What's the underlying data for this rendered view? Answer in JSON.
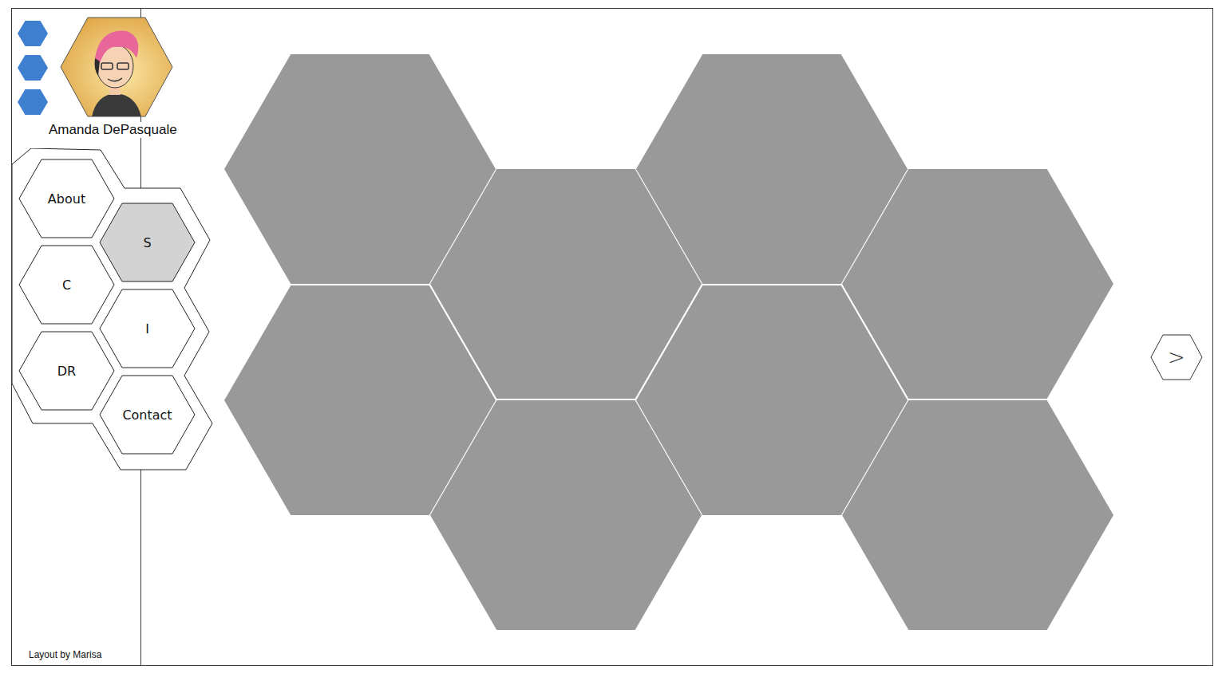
{
  "profile": {
    "name": "Amanda DePasquale"
  },
  "nav": {
    "items": [
      {
        "label": "About",
        "selected": false
      },
      {
        "label": "S",
        "selected": true
      },
      {
        "label": "C",
        "selected": false
      },
      {
        "label": "I",
        "selected": false
      },
      {
        "label": "DR",
        "selected": false
      },
      {
        "label": "Contact",
        "selected": false
      }
    ]
  },
  "next_button": {
    "label": ">"
  },
  "footer": {
    "credit": "Layout by Marisa"
  }
}
